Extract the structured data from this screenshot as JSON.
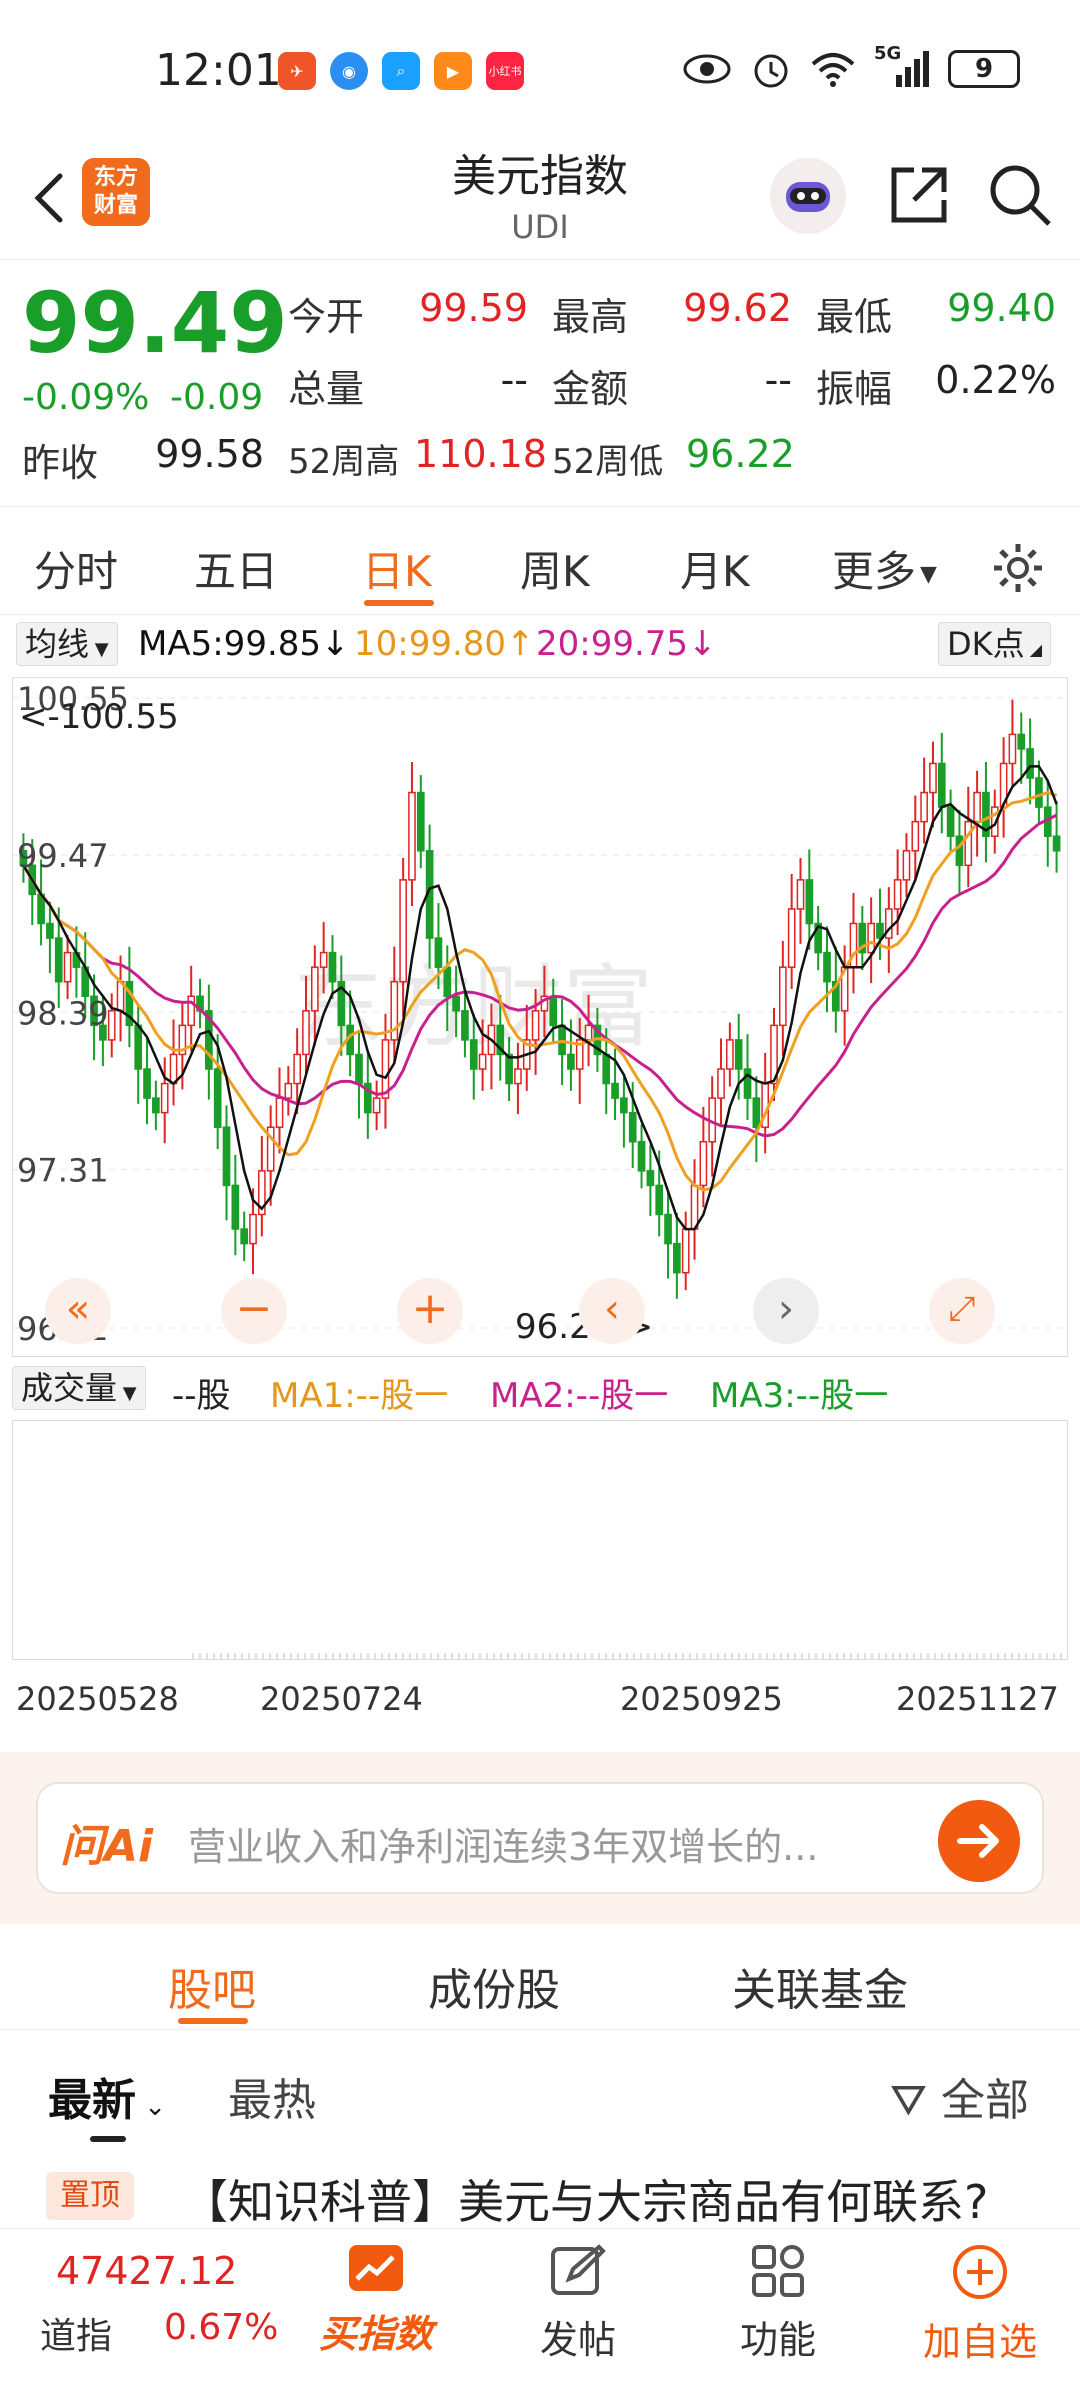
{
  "status_bar": {
    "time": "12:01",
    "network": "5G",
    "battery": "9",
    "apps": [
      {
        "icon": "app-red-icon",
        "color": "#f0552a"
      },
      {
        "icon": "app-globe-icon",
        "color": "#2a8ff0"
      },
      {
        "icon": "app-search-icon",
        "color": "#1aa0ff"
      },
      {
        "icon": "app-play-icon",
        "color": "#ff8a1a"
      },
      {
        "icon": "app-xiaohongshu-icon",
        "color": "#ff2442",
        "label": "小红书"
      }
    ]
  },
  "header": {
    "logo_line1": "东方",
    "logo_line2": "财富",
    "title": "美元指数",
    "subtitle": "UDI"
  },
  "quote": {
    "price": "99.49",
    "change_pct": "-0.09%",
    "change_abs": "-0.09",
    "prev_close_label": "昨收",
    "prev_close": "99.58",
    "open_label": "今开",
    "open": "99.59",
    "high_label": "最高",
    "high": "99.62",
    "low_label": "最低",
    "low": "99.40",
    "volume_label": "总量",
    "volume": "--",
    "amount_label": "金额",
    "amount": "--",
    "amplitude_label": "振幅",
    "amplitude": "0.22%",
    "w52_high_label": "52周高",
    "w52_high": "110.18",
    "w52_low_label": "52周低",
    "w52_low": "96.22"
  },
  "tabs": [
    {
      "label": "分时"
    },
    {
      "label": "五日"
    },
    {
      "label": "日K"
    },
    {
      "label": "周K"
    },
    {
      "label": "月K"
    },
    {
      "label": "更多"
    }
  ],
  "ma_bar": {
    "selector": "均线",
    "ma5": "MA5:99.85",
    "ma10": "10:99.80",
    "ma20": "20:99.75",
    "dk": "DK点"
  },
  "colors": {
    "accent": "#f26a1b",
    "up": "#e02323",
    "down": "#1a9e2a",
    "ma5": "#111111",
    "ma10": "#f0a020",
    "ma20": "#c8208c"
  },
  "chart_data": {
    "type": "candlestick",
    "price_max_label": "<-100.55",
    "price_min_label": "96.22->",
    "y_ticks": [
      "100.55",
      "99.47",
      "98.39",
      "97.31",
      "96.22"
    ],
    "ylim": [
      96.22,
      100.55
    ],
    "x_ticks": [
      "20250528",
      "20250724",
      "20250925",
      "20251127"
    ],
    "close": [
      99.4,
      99.2,
      99.0,
      98.9,
      98.6,
      98.8,
      98.7,
      98.5,
      98.3,
      98.2,
      98.4,
      98.6,
      98.3,
      98.0,
      97.8,
      97.7,
      97.9,
      98.1,
      98.3,
      98.5,
      98.4,
      98.0,
      97.6,
      97.2,
      96.9,
      96.8,
      97.0,
      97.3,
      97.6,
      97.8,
      97.9,
      98.1,
      98.4,
      98.7,
      98.8,
      98.6,
      98.3,
      98.1,
      97.9,
      97.7,
      97.8,
      98.2,
      98.6,
      99.3,
      99.9,
      99.5,
      98.9,
      98.7,
      98.5,
      98.4,
      98.2,
      98.0,
      98.1,
      98.3,
      98.1,
      97.9,
      98.0,
      98.2,
      98.4,
      98.5,
      98.3,
      98.1,
      98.0,
      98.2,
      98.3,
      98.1,
      97.9,
      97.8,
      97.7,
      97.5,
      97.3,
      97.2,
      97.0,
      96.8,
      96.6,
      96.9,
      97.2,
      97.5,
      97.8,
      98.0,
      98.2,
      98.0,
      97.8,
      97.6,
      97.9,
      98.3,
      98.7,
      99.1,
      99.3,
      99.0,
      98.8,
      98.6,
      98.4,
      98.7,
      99.0,
      98.8,
      99.0,
      98.9,
      99.1,
      99.3,
      99.5,
      99.7,
      99.9,
      100.1,
      99.8,
      99.6,
      99.4,
      99.7,
      99.9,
      99.6,
      99.8,
      100.1,
      100.3,
      100.2,
      100.0,
      99.8,
      99.6,
      99.5
    ],
    "ma5_last": 99.85,
    "ma10_last": 99.8,
    "ma20_last": 99.75
  },
  "volume_bar": {
    "selector": "成交量",
    "unit": "--股",
    "ma1": "MA1:--股一",
    "ma2": "MA2:--股一",
    "ma3": "MA3:--股一"
  },
  "ai": {
    "logo": "问Ai",
    "text": "营业收入和净利润连续3年双增长的..."
  },
  "sub_tabs": [
    {
      "label": "股吧"
    },
    {
      "label": "成份股"
    },
    {
      "label": "关联基金"
    }
  ],
  "filter": {
    "latest": "最新",
    "hottest": "最热",
    "all": "全部"
  },
  "pinned": {
    "badge": "置顶",
    "text": "【知识科普】美元与大宗商品有何联系?"
  },
  "bottom_bar": {
    "ticker_value": "47427.12",
    "ticker_name": "道指",
    "ticker_pct": "0.67%",
    "buy_label": "买指数",
    "post_label": "发帖",
    "function_label": "功能",
    "watch_label": "加自选"
  }
}
